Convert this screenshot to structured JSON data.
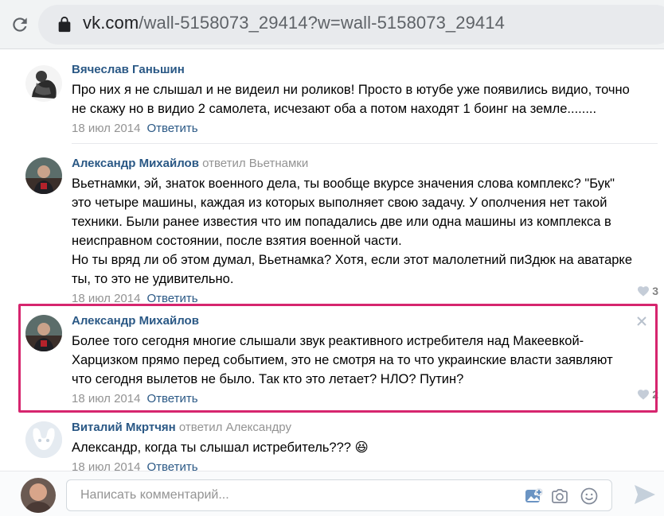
{
  "browser": {
    "url_host": "vk.com",
    "url_path": "/wall-5158073_29414?w=wall-5158073_29414"
  },
  "comments": [
    {
      "author": "Вячеслав Ганьшин",
      "reply_to": "",
      "lines": [
        "Про них я не слышал и не видеил ни роликов! Просто в ютубе уже появились видио, точно",
        "не скажу но в видио 2 самолета, исчезают оба а потом находят 1 боинг на земле........"
      ],
      "date": "18 июл 2014",
      "reply_label": "Ответить",
      "likes": ""
    },
    {
      "author": "Александр Михайлов",
      "reply_to": "ответил Вьетнамки",
      "lines": [
        "Вьетнамки, эй, знаток военного дела, ты вообще вкурсе значения слова комплекс? \"Бук\"",
        "это четыре машины, каждая из которых выполняет свою задачу. У ополчения нет такой",
        "техники. Были ранее известия что им попадались две или одна машины из комплекса в",
        "неисправном состоянии, после взятия военной части.",
        "Но ты вряд ли об этом думал, Вьетнамка? Хотя, если этот малолетний пиЗдюк на аватарке",
        "ты, то это не удивительно."
      ],
      "date": "18 июл 2014",
      "reply_label": "Ответить",
      "likes": "3"
    },
    {
      "author": "Александр Михайлов",
      "reply_to": "",
      "lines": [
        "Более того сегодня многие слышали звук реактивного истребителя над Макеевкой-",
        "Харцизком прямо перед событием, это не смотря на то что украинские власти заявляют",
        "что сегодня вылетов не было. Так кто это летает? НЛО? Путин?"
      ],
      "date": "18 июл 2014",
      "reply_label": "Ответить",
      "likes": "2"
    },
    {
      "author": "Виталий Мкртчян",
      "reply_to": "ответил Александру",
      "lines": [
        "Александр, когда ты слышал истребитель??? 😆"
      ],
      "date": "18 июл 2014",
      "reply_label": "Ответить",
      "likes": ""
    }
  ],
  "composer": {
    "placeholder": "Написать комментарий...",
    "icons": [
      "attach-photo-icon",
      "camera-icon",
      "emoji-icon",
      "send-icon"
    ]
  },
  "colors": {
    "link": "#2a5885",
    "muted": "#939393",
    "highlight": "#d6256e"
  }
}
